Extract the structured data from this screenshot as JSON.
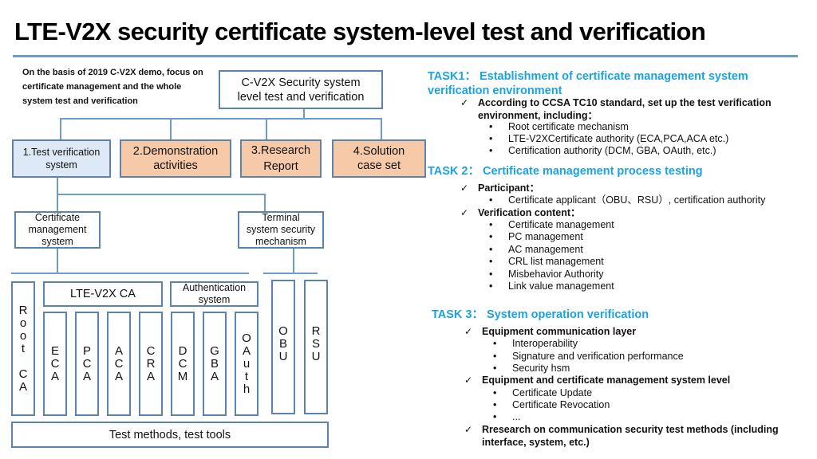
{
  "title": "LTE-V2X security certificate system-level test and verification",
  "intro": "On the basis of 2019 C-V2X demo, focus on certificate management and the whole system test and verification",
  "diagram": {
    "root": {
      "line1": "C-V2X Security system",
      "line2": "level test and verification"
    },
    "level1": [
      {
        "line1": "1.Test verification",
        "line2": "system"
      },
      {
        "line1": "2.Demonstration",
        "line2": "activities"
      },
      {
        "line1": "3.Research",
        "line2": "Report"
      },
      {
        "line1": "4.Solution",
        "line2": "case set"
      }
    ],
    "level2": [
      {
        "line1": "Certificate",
        "line2": "management",
        "line3": "system"
      },
      {
        "line1": "Terminal",
        "line2": "system security",
        "line3": "mechanism"
      }
    ],
    "ca_group": "LTE-V2X CA",
    "auth_group": {
      "line1": "Authentication",
      "line2": "system"
    },
    "columns": {
      "root_ca": [
        "R",
        "o",
        "o",
        "t",
        "",
        "C",
        "A"
      ],
      "eca": [
        "E",
        "C",
        "A"
      ],
      "pca": [
        "P",
        "C",
        "A"
      ],
      "aca": [
        "A",
        "C",
        "A"
      ],
      "cra": [
        "C",
        "R",
        "A"
      ],
      "dcm": [
        "D",
        "C",
        "M"
      ],
      "gba": [
        "G",
        "B",
        "A"
      ],
      "oauth": [
        "O",
        "A",
        "u",
        "t",
        "h"
      ],
      "obu": [
        "O",
        "B",
        "U"
      ],
      "rsu": [
        "R",
        "S",
        "U"
      ]
    },
    "footer": "Test methods, test tools"
  },
  "tasks": {
    "task1": {
      "heading_line1": "TASK1： Establishment of certificate management system",
      "heading_line2": "verification environment",
      "check1_line1": "According to CCSA TC10 standard, set up the test verification",
      "check1_line2": "environment, including：",
      "bullets": [
        "Root certificate mechanism",
        "LTE-V2XCertificate authority (ECA,PCA,ACA etc.)",
        "Certification authority (DCM, GBA, OAuth, etc.)"
      ]
    },
    "task2": {
      "heading": "TASK 2： Certificate management process testing",
      "check1": "Participant：",
      "check1_bullets": [
        "Certificate applicant（OBU、RSU）, certification authority"
      ],
      "check2": "Verification content：",
      "check2_bullets": [
        "Certificate management",
        "PC management",
        "AC management",
        "CRL list management",
        "Misbehavior Authority",
        "Link value management"
      ]
    },
    "task3": {
      "heading": "TASK 3： System operation verification",
      "check1": "Equipment communication layer",
      "check1_bullets": [
        "Interoperability",
        "Signature and verification performance",
        "Security hsm"
      ],
      "check2": "Equipment and certificate management system level",
      "check2_bullets": [
        "Certificate Update",
        "Certificate Revocation",
        "..."
      ],
      "check3_line1": "Rresearch on communication security test methods (including",
      "check3_line2": "interface, system, etc.)"
    }
  },
  "symbols": {
    "check": "✓",
    "bullet": "•"
  },
  "colors": {
    "accent": "#1aa3e0",
    "border": "#5b83ad",
    "orange_fill": "#f6c9a8",
    "blue_fill": "#dde9f6",
    "rule": "#6f9bcc"
  }
}
